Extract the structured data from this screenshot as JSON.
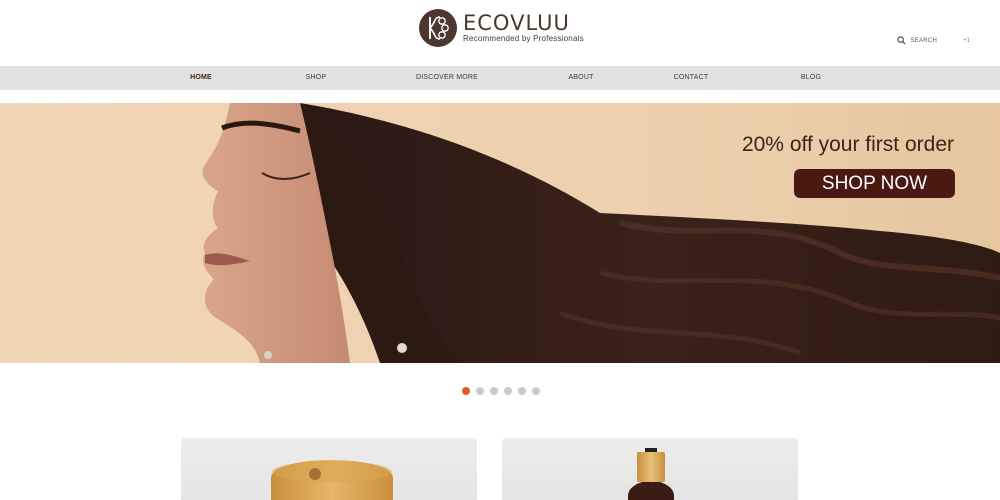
{
  "brand": {
    "name": "ECOVLUU",
    "tagline": "Recommended by Professionals"
  },
  "utility": {
    "search_label": "SEARCH",
    "lang_label": "+1"
  },
  "nav": {
    "items": [
      {
        "label": "HOME",
        "active": true
      },
      {
        "label": "SHOP",
        "active": false
      },
      {
        "label": "DISCOVER MORE",
        "active": false
      },
      {
        "label": "ABOUT",
        "active": false
      },
      {
        "label": "CONTACT",
        "active": false
      },
      {
        "label": "BLOG",
        "active": false
      }
    ]
  },
  "hero": {
    "offer_text": "20% off your first order",
    "cta_label": "SHOP NOW"
  },
  "carousel": {
    "slide_count": 6,
    "active_index": 0
  },
  "colors": {
    "brand_brown": "#4a1a12",
    "accent_orange": "#e05a27",
    "nav_bg": "#e2e2e2"
  }
}
